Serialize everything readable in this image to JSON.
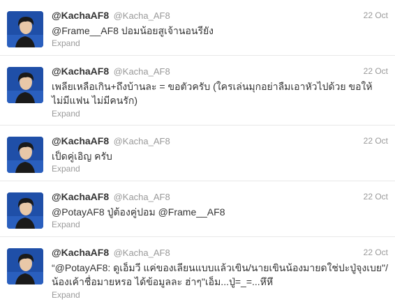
{
  "colors": {
    "name": "#333333",
    "muted": "#999999",
    "divider": "#e8e8e8",
    "avatar_bg": "#1f4fa8"
  },
  "tweets": [
    {
      "name": "@KachaAF8",
      "handle": "@Kacha_AF8",
      "date": "22 Oct",
      "text": "@Frame__AF8 ปอมน้อยสูเจ้านอนรียัง",
      "expand": "Expand",
      "avatar_icon": "profile-photo"
    },
    {
      "name": "@KachaAF8",
      "handle": "@Kacha_AF8",
      "date": "22 Oct",
      "text": "เพลียเหลือเกิน+ถึงบ้านละ = ขอตัวครับ (ใครเล่นมุกอย่าลืมเอาหัวไปด้วย ขอให้ไม่มีแฟน ไม่มีคนรัก)",
      "expand": "Expand",
      "avatar_icon": "profile-photo"
    },
    {
      "name": "@KachaAF8",
      "handle": "@Kacha_AF8",
      "date": "22 Oct",
      "text": "เป็ดคู่เอิญ ครับ",
      "expand": "Expand",
      "avatar_icon": "profile-photo"
    },
    {
      "name": "@KachaAF8",
      "handle": "@Kacha_AF8",
      "date": "22 Oct",
      "text": "@PotayAF8 ปู่ต้องคู่ปอม @Frame__AF8",
      "expand": "Expand",
      "avatar_icon": "profile-photo"
    },
    {
      "name": "@KachaAF8",
      "handle": "@Kacha_AF8",
      "date": "22 Oct",
      "text": "“@PotayAF8: ดูเอ็มวี แค่ของเลียนแบบแล้วเขิน/นายเขินน้องมายดใช่ปะปู่จุงเบย\"/น้องเค้าชื่อมายหรอ ได้ข้อมูลละ ฮ่าๆ\"เอ็ม...ปู่=_=...หึหึ",
      "expand": "Expand",
      "avatar_icon": "profile-photo"
    }
  ]
}
